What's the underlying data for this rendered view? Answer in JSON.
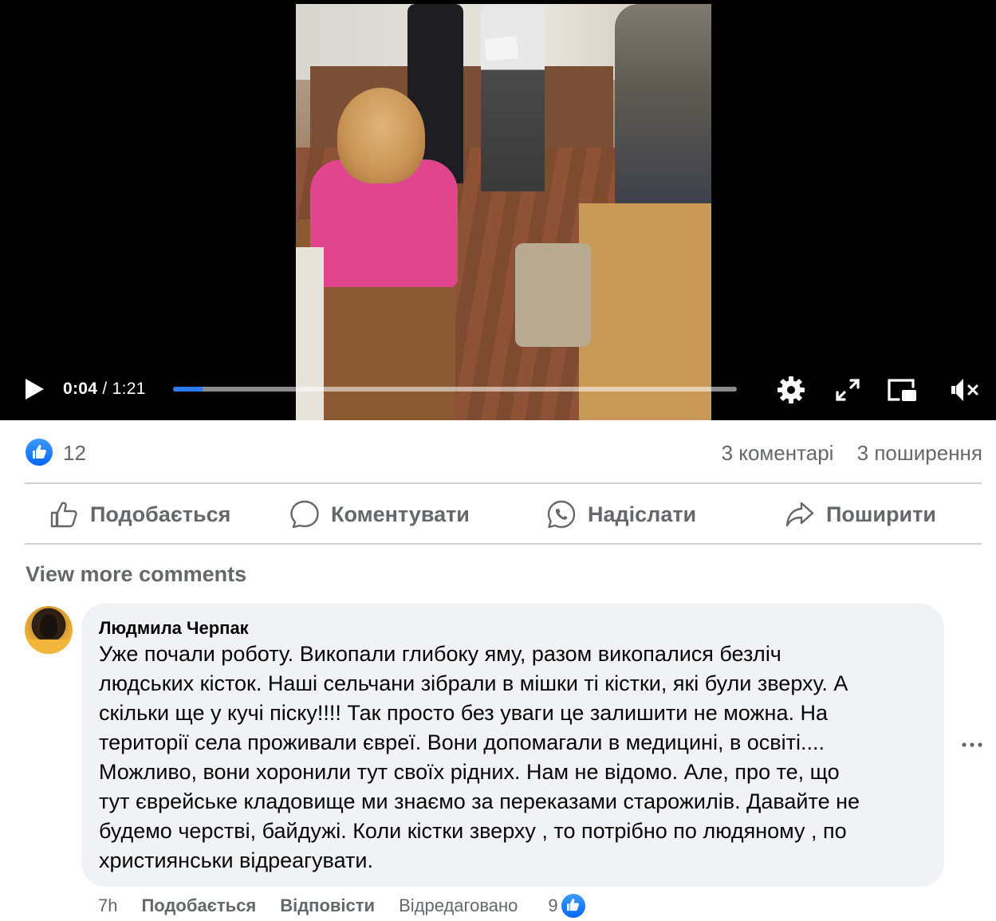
{
  "video": {
    "current_time": "0:04",
    "separator": "/",
    "duration": "1:21",
    "progress_fraction": 0.054
  },
  "stats": {
    "like_count": "12",
    "comments": "3 коментарі",
    "shares": "3 поширення"
  },
  "actions": {
    "like": "Подобається",
    "comment": "Коментувати",
    "send": "Надіслати",
    "share": "Поширити"
  },
  "view_more": "View more comments",
  "comment": {
    "author": "Людмила Черпак",
    "lines": [
      "Уже почали роботу. Викопали глибоку яму, разом викопалися безліч",
      "людських кісток. Наші сельчани зібрали в мішки ті кістки, які були зверху. А",
      "скільки ще у кучі піску!!!! Так просто без уваги це залишити не можна. На",
      "території села проживали євреї. Вони допомагали в медицині, в освіті....",
      "Можливо, вони хоронили тут своїх рідних. Нам не відомо. Але, про те, що",
      "тут єврейське кладовище ми знаємо за переказами старожилів. Давайте не",
      "будемо черстві, байдужі. Коли кістки зверху , то потрібно по людяному , по",
      "християнськи відреагувати."
    ],
    "time": "7h",
    "like": "Подобається",
    "reply": "Відповісти",
    "edited": "Відредаговано",
    "reaction_count": "9"
  },
  "colors": {
    "accent_blue": "#0866ff",
    "secondary_text": "#65676b",
    "bubble_bg": "#f0f2f5"
  }
}
